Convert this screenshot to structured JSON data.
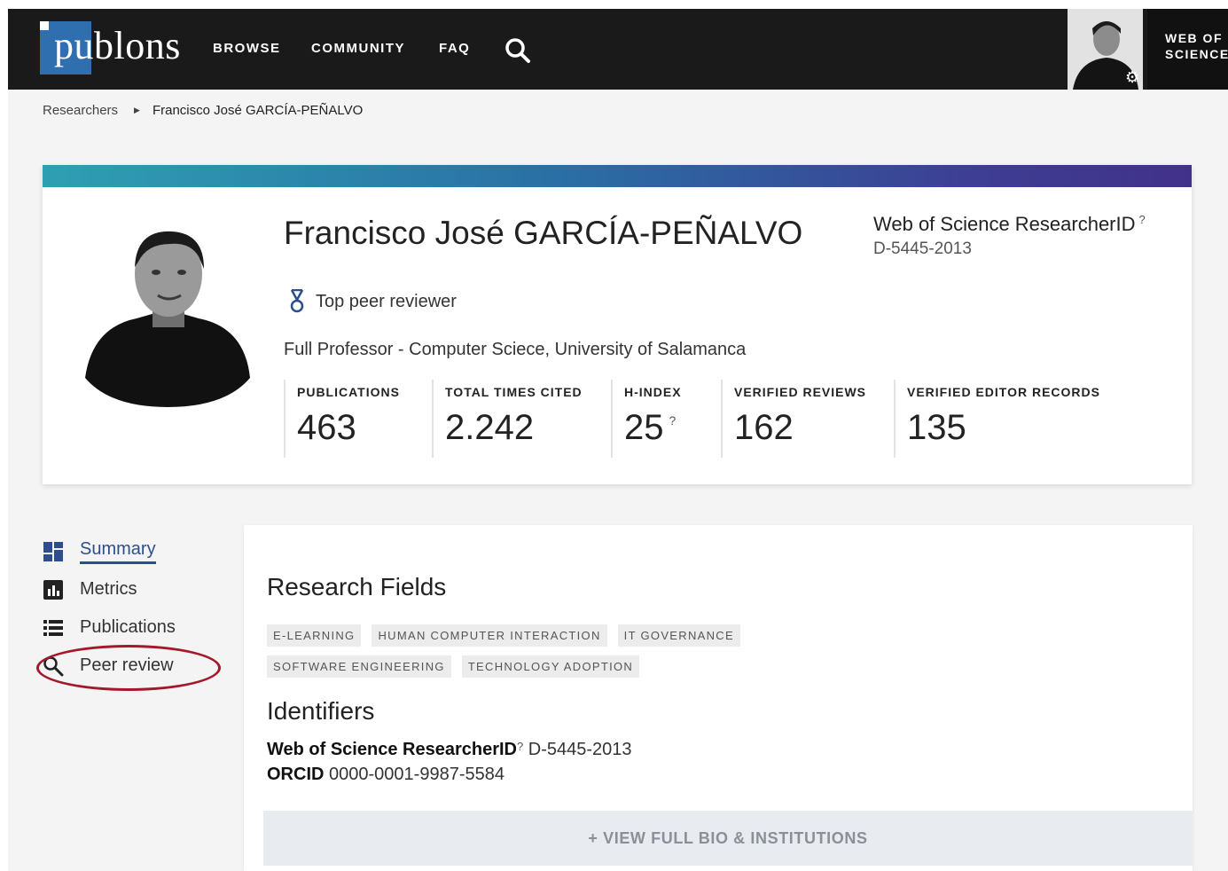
{
  "nav": {
    "logo": "publons",
    "links": [
      "BROWSE",
      "COMMUNITY",
      "FAQ"
    ],
    "wos_label": "WEB OF\nSCIENCE"
  },
  "breadcrumb": {
    "root": "Researchers",
    "current": "Francisco José GARCÍA-PEÑALVO"
  },
  "profile": {
    "name": "Francisco José GARCÍA-PEÑALVO",
    "badge": "Top peer reviewer",
    "role": "Full Professor - Computer Sciece, University of Salamanca",
    "researcher_id_label": "Web of Science ResearcherID",
    "researcher_id_help": "?",
    "researcher_id": "D-5445-2013",
    "stats": [
      {
        "label": "PUBLICATIONS",
        "value": "463"
      },
      {
        "label": "TOTAL TIMES CITED",
        "value": "2.242"
      },
      {
        "label": "H-INDEX",
        "value": "25"
      },
      {
        "label": "VERIFIED REVIEWS",
        "value": "162"
      },
      {
        "label": "VERIFIED EDITOR RECORDS",
        "value": "135"
      }
    ],
    "h_index_help": "?"
  },
  "sidenav": {
    "items": [
      {
        "label": "Summary",
        "icon": "dashboard-icon"
      },
      {
        "label": "Metrics",
        "icon": "bar-chart-icon"
      },
      {
        "label": "Publications",
        "icon": "list-icon"
      },
      {
        "label": "Peer review",
        "icon": "search-icon"
      }
    ],
    "active": "Summary",
    "highlight_color": "#a3192a"
  },
  "main": {
    "research_fields_title": "Research Fields",
    "tags": [
      "E-LEARNING",
      "HUMAN COMPUTER INTERACTION",
      "IT GOVERNANCE",
      "SOFTWARE ENGINEERING",
      "TECHNOLOGY ADOPTION"
    ],
    "identifiers_title": "Identifiers",
    "identifiers": {
      "wos_label": "Web of Science ResearcherID",
      "wos_help": "?",
      "wos_value": "D-5445-2013",
      "orcid_label": "ORCID",
      "orcid_value": "0000-0001-9987-5584"
    },
    "bio_button": "+ VIEW FULL BIO & INSTITUTIONS"
  },
  "colors": {
    "nav_bg": "#1a1a1a",
    "logo_blue": "#2f6faf",
    "accent": "#2d4e8e",
    "bar_start": "#2f9fb3",
    "bar_end": "#42318a"
  }
}
